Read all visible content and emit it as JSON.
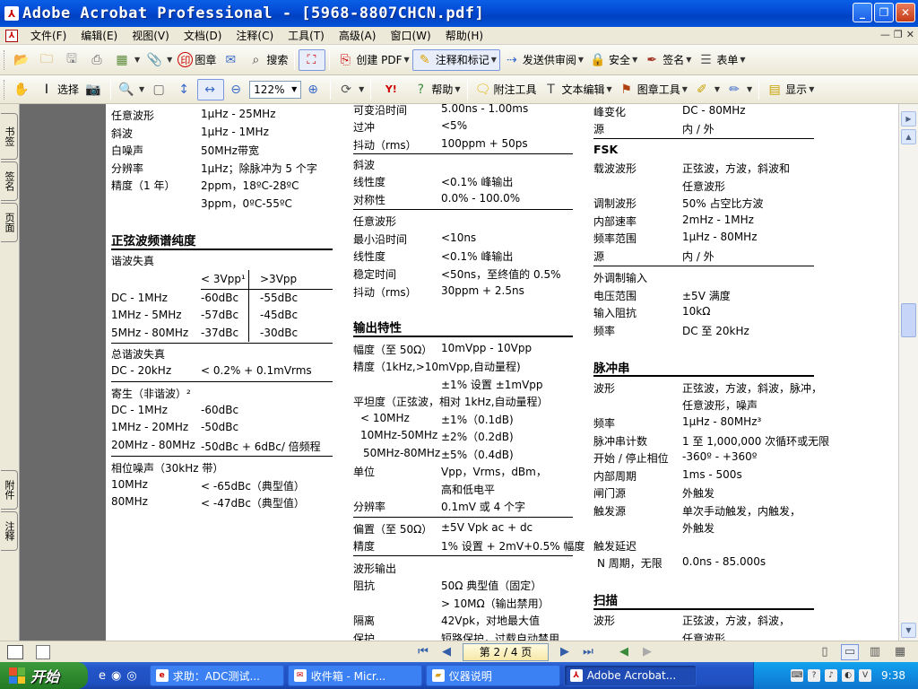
{
  "window": {
    "title": "Adobe Acrobat Professional - [5968-8807CHCN.pdf]",
    "app_icon": "acrobat-icon"
  },
  "menu": [
    "文件(F)",
    "编辑(E)",
    "视图(V)",
    "文档(D)",
    "注释(C)",
    "工具(T)",
    "高级(A)",
    "窗口(W)",
    "帮助(H)"
  ],
  "toolbar1": {
    "stamp": "图章",
    "search": "搜索",
    "create_pdf": "创建 PDF",
    "comment_markup": "注释和标记",
    "send_review": "发送供审阅",
    "security": "安全",
    "sign": "签名",
    "forms": "表单"
  },
  "toolbar2": {
    "select": "选择",
    "zoom_value": "122%",
    "help": "帮助",
    "attach_tool": "附注工具",
    "text_edit": "文本编辑",
    "stamp_tool": "图章工具",
    "display": "显示"
  },
  "side_tabs": [
    "书签",
    "签名",
    "页面",
    "附件",
    "注释"
  ],
  "doc": {
    "col1": {
      "rows_top": [
        [
          "任意波形",
          "1µHz - 25MHz"
        ],
        [
          "斜波",
          "1µHz - 1MHz"
        ],
        [
          "白噪声",
          "50MHz带宽"
        ],
        [
          "分辨率",
          "1µHz；除脉冲为 5 个字"
        ],
        [
          "精度（1 年）",
          "2ppm，18ºC-28ºC"
        ],
        [
          "",
          "3ppm，0ºC-55ºC"
        ]
      ],
      "spectral_heading": "正弦波频谱纯度",
      "harmonic_label": "谐波失真",
      "harmonic_header": [
        "< 3Vpp¹",
        ">3Vpp"
      ],
      "harmonic_rows": [
        [
          "DC - 1MHz",
          "-60dBc",
          "-55dBc"
        ],
        [
          "1MHz - 5MHz",
          "-57dBc",
          "-45dBc"
        ],
        [
          "5MHz - 80MHz",
          "-37dBc",
          "-30dBc"
        ]
      ],
      "thd_label": "总谐波失真",
      "thd_row": [
        "DC - 20kHz",
        "< 0.2% + 0.1mVrms"
      ],
      "spurious_label": "寄生（非谐波）²",
      "spurious_rows": [
        [
          "DC - 1MHz",
          "-60dBc"
        ],
        [
          "1MHz - 20MHz",
          "-50dBc"
        ],
        [
          "20MHz - 80MHz",
          "-50dBc + 6dBc/ 倍频程"
        ]
      ],
      "phase_noise_label": "相位噪声（30kHz 带）",
      "phase_noise_rows": [
        [
          "10MHz",
          "< -65dBc（典型值）"
        ],
        [
          "80MHz",
          "< -47dBc（典型值）"
        ]
      ]
    },
    "col2": {
      "top_rows": [
        [
          "可变沿时间",
          "5.00ns - 1.00ms"
        ],
        [
          "过冲",
          "<5%"
        ],
        [
          "抖动（rms）",
          "100ppm + 50ps"
        ]
      ],
      "ramp_label": "斜波",
      "ramp_rows": [
        [
          "线性度",
          "<0.1% 峰输出"
        ],
        [
          "对称性",
          "0.0% - 100.0%"
        ]
      ],
      "arb_label": "任意波形",
      "arb_rows": [
        [
          "最小沿时间",
          "<10ns"
        ],
        [
          "线性度",
          "<0.1% 峰输出"
        ],
        [
          "稳定时间",
          "<50ns，至终值的 0.5%"
        ],
        [
          "抖动（rms）",
          "30ppm + 2.5ns"
        ]
      ],
      "output_heading": "输出特性",
      "amp_row": [
        "幅度（至 50Ω）",
        "10mVpp - 10Vpp"
      ],
      "acc_row": [
        "精度（1kHz,>10mVpp,自动量程)",
        ""
      ],
      "acc_val": "±1% 设置 ±1mVpp",
      "flat_label": "平坦度（正弦波，相对 1kHz,自动量程）",
      "flat_rows": [
        [
          "< 10MHz",
          "±1%（0.1dB)"
        ],
        [
          "10MHz-50MHz",
          "±2%（0.2dB)"
        ],
        [
          "50MHz-80MHz",
          "±5%（0.4dB)"
        ]
      ],
      "unit_row": [
        "单位",
        "Vpp，Vrms，dBm，"
      ],
      "unit_row2": "高和低电平",
      "res_row": [
        "分辨率",
        "0.1mV 或 4 个字"
      ],
      "offset_row": [
        "偏置（至 50Ω）",
        "±5V Vpk ac + dc"
      ],
      "offset_acc_row": [
        "精度",
        "1% 设置 + 2mV+0.5% 幅度"
      ],
      "wave_out_label": "波形输出",
      "imp_row": [
        "阻抗",
        "50Ω 典型值（固定）"
      ],
      "imp_row2": "> 10MΩ（输出禁用）",
      "iso_row": [
        "隔离",
        "42Vpk，对地最大值"
      ],
      "prot_row": [
        "保护",
        "短路保护，过载自动禁用"
      ]
    },
    "col3": {
      "top_rows": [
        [
          "峰变化",
          "DC - 80MHz"
        ],
        [
          "源",
          "内 / 外"
        ]
      ],
      "fsk_heading": "FSK",
      "fsk_rows": [
        [
          "载波波形",
          "正弦波，方波，斜波和"
        ],
        [
          "",
          "任意波形"
        ],
        [
          "调制波形",
          "50% 占空比方波"
        ],
        [
          "内部速率",
          "2mHz - 1MHz"
        ],
        [
          "频率范围",
          "1µHz - 80MHz"
        ],
        [
          "源",
          "内 / 外"
        ]
      ],
      "ext_mod_label": "外调制输入",
      "ext_rows": [
        [
          "电压范围",
          "±5V 满度"
        ],
        [
          "输入阻抗",
          "10kΩ"
        ],
        [
          "频率",
          "DC 至 20kHz"
        ]
      ],
      "burst_heading": "脉冲串",
      "burst_rows": [
        [
          "波形",
          "正弦波，方波，斜波，脉冲，"
        ],
        [
          "",
          "任意波形，噪声"
        ],
        [
          "频率",
          "1µHz - 80MHz³"
        ],
        [
          "脉冲串计数",
          "1 至 1,000,000 次循环或无限"
        ],
        [
          "开始 / 停止相位",
          "-360º - +360º"
        ],
        [
          "内部周期",
          "1ms - 500s"
        ],
        [
          "闸门源",
          "外触发"
        ],
        [
          "触发源",
          "单次手动触发，内触发，"
        ],
        [
          "",
          "外触发"
        ],
        [
          "触发延迟",
          ""
        ],
        [
          " N 周期，无限",
          "0.0ns - 85.000s"
        ]
      ],
      "sweep_heading": "扫描",
      "sweep_rows": [
        [
          "波形",
          "正弦波，方波，斜波，"
        ],
        [
          "",
          "任意波形"
        ]
      ]
    }
  },
  "status": {
    "page_indicator": "第 2 / 4 页"
  },
  "taskbar": {
    "start": "开始",
    "tasks": [
      "求助：ADC测试...",
      "收件箱 - Micr...",
      "仪器说明",
      "Adobe Acrobat..."
    ],
    "clock": "9:38"
  }
}
